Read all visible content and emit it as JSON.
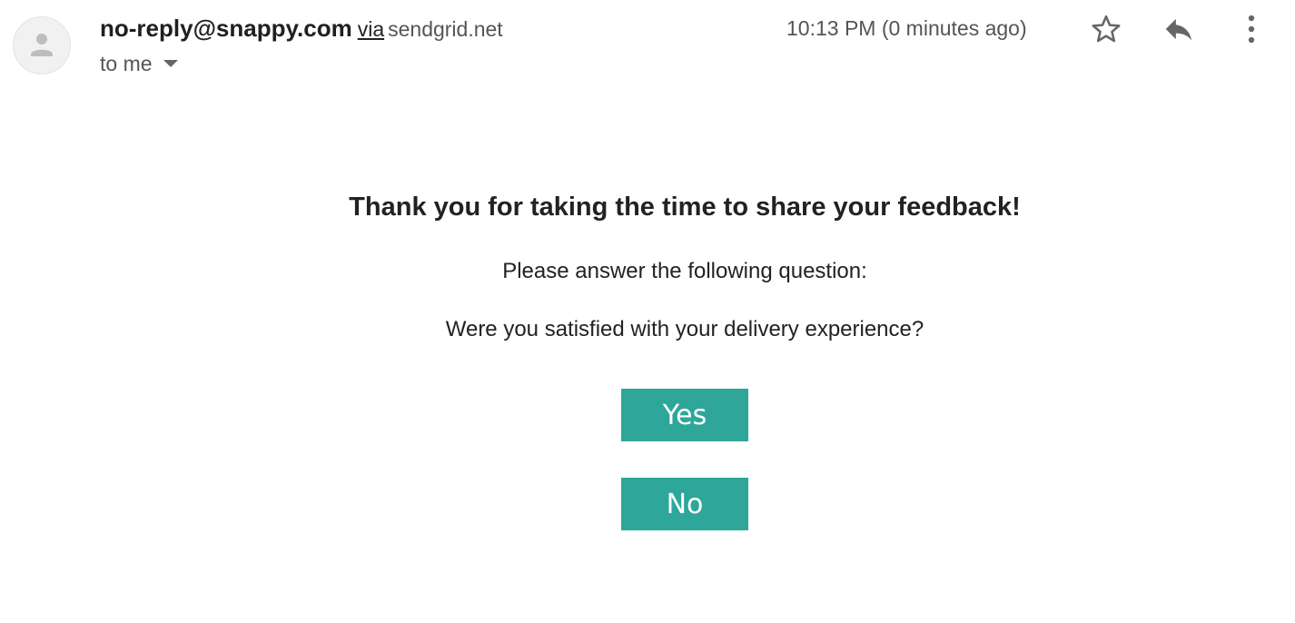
{
  "email": {
    "sender_email": "no-reply@snappy.com",
    "via_label": "via",
    "via_domain": "sendgrid.net",
    "recipient_label": "to me",
    "timestamp": "10:13 PM (0 minutes ago)"
  },
  "body": {
    "title": "Thank you for taking the time to share your feedback!",
    "instruction": "Please answer the following question:",
    "question": "Were you satisfied with your delivery experience?",
    "yes_label": "Yes",
    "no_label": "No"
  },
  "icons": {
    "avatar": "person-icon",
    "star": "star-icon",
    "reply": "reply-icon",
    "more": "more-vert-icon",
    "caret": "caret-down-icon"
  },
  "colors": {
    "button_bg": "#2ea79a",
    "button_text": "#ffffff",
    "icon_gray": "#666666"
  }
}
